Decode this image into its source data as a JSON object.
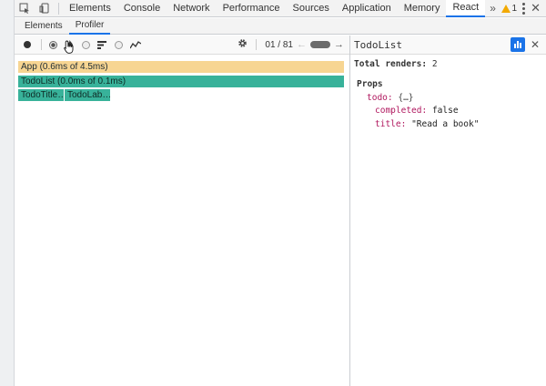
{
  "main_tabs": [
    "Elements",
    "Console",
    "Network",
    "Performance",
    "Sources",
    "Application",
    "Memory",
    "React"
  ],
  "main_more": "»",
  "warning_count": "1",
  "close_glyph": "✕",
  "sub_tabs": [
    "Elements",
    "Profiler"
  ],
  "commit": {
    "label": "01 / 81",
    "prev": "←",
    "next": "→"
  },
  "flame": {
    "app": "App (0.6ms of 4.5ms)",
    "todolist": "TodoList (0.0ms of 0.1ms)",
    "children": [
      "TodoTitle…",
      "TodoLab…"
    ]
  },
  "side": {
    "title": "TodoList",
    "close_glyph": "✕",
    "renders_label": "Total renders:",
    "renders_value": "2",
    "props_header": "Props",
    "props": {
      "todo_key": "todo",
      "todo_value": "{…}",
      "completed_key": "completed",
      "completed_value": "false",
      "title_key": "title",
      "title_value": "\"Read a book\""
    }
  },
  "colors": {
    "accent": "#1a73e8",
    "app_bar": "#f7d592",
    "component_bar": "#38b29a",
    "prop_key": "#b0175e",
    "warning": "#f2a900"
  }
}
